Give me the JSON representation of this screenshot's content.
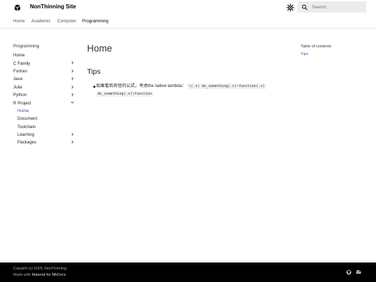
{
  "header": {
    "site_title": "NonThinning Site",
    "search_placeholder": "Search"
  },
  "tabs": [
    "Home",
    "Academic",
    "Computer",
    "Programming"
  ],
  "active_tab": "Programming",
  "nav": {
    "title": "Programming",
    "items": [
      {
        "label": "Home",
        "chevron": false
      },
      {
        "label": "C Family",
        "chevron": "right"
      },
      {
        "label": "Fortran",
        "chevron": "right"
      },
      {
        "label": "Java",
        "chevron": "right"
      },
      {
        "label": "Julia",
        "chevron": "right"
      },
      {
        "label": "Python",
        "chevron": "right"
      },
      {
        "label": "R Project",
        "chevron": "down"
      }
    ],
    "sub_items": [
      {
        "label": "Home",
        "chevron": false,
        "current": true
      },
      {
        "label": "Document",
        "chevron": false
      },
      {
        "label": "Toolchain",
        "chevron": false
      },
      {
        "label": "Learning",
        "chevron": "right"
      },
      {
        "label": "Packages",
        "chevron": "right"
      }
    ]
  },
  "content": {
    "title": "Home",
    "section": "Tips",
    "bullet_text": "如果看到奇怪的公式，考虑the native lambda：",
    "code1": "\\(.x) do_something(.x)~function(.x)",
    "code2": "do_something(.x)\\function"
  },
  "toc": {
    "title": "Table of contents",
    "links": [
      "Tips"
    ]
  },
  "footer": {
    "copyright": "Copyleft (ɔ) 2025, NonThinning.",
    "made_with_prefix": "Made with",
    "made_with_link": "Material for MkDocs"
  },
  "colors": {
    "accent": "#3f51b5",
    "footer_bg": "#000000"
  },
  "icons": [
    "logo-icon",
    "palette-icon",
    "search-icon",
    "chevron-right-icon",
    "chevron-down-icon",
    "github-icon",
    "docker-icon"
  ]
}
